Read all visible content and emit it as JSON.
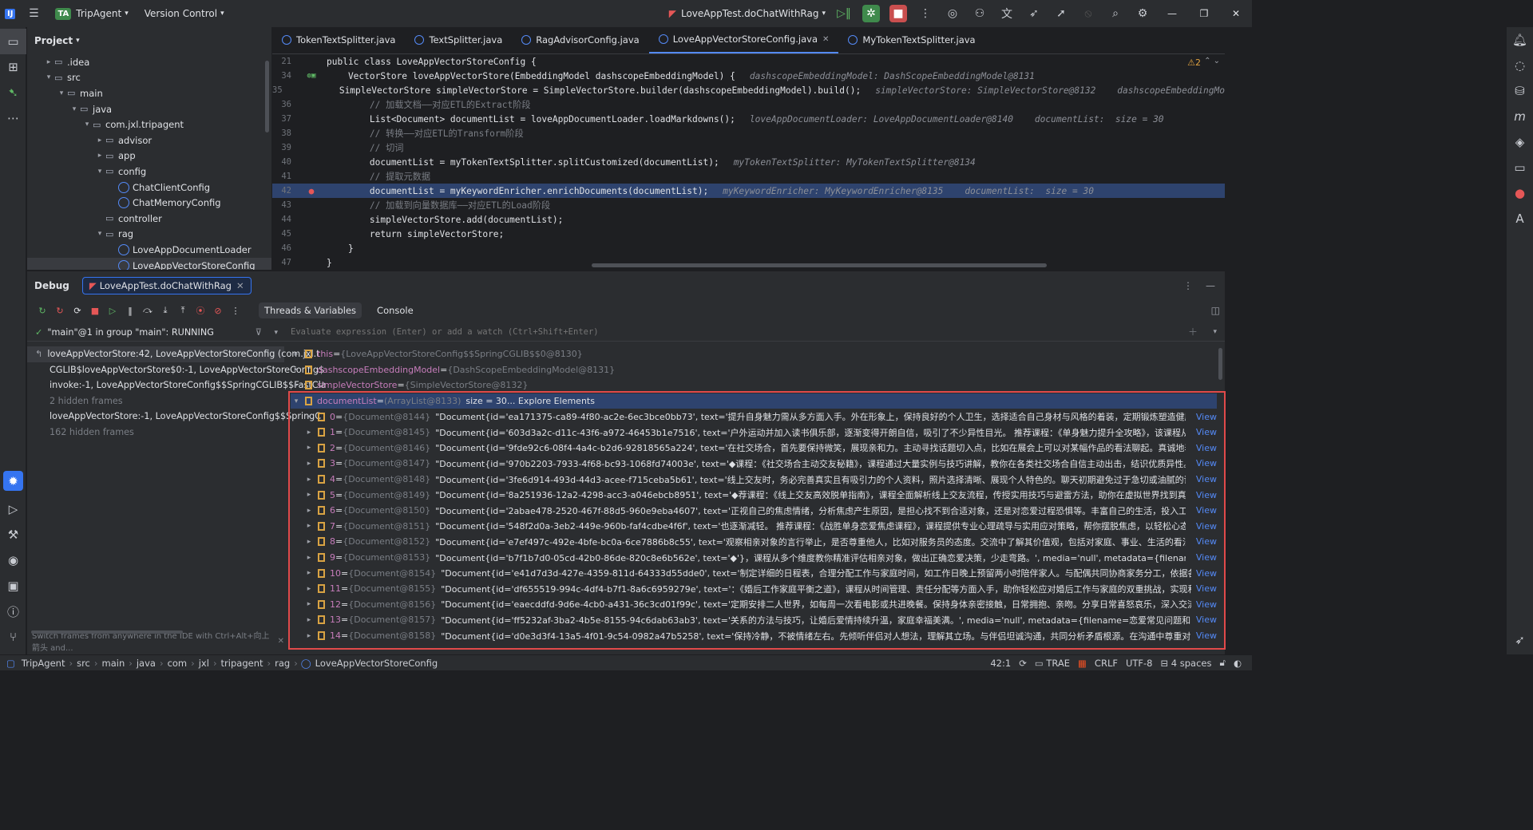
{
  "titlebar": {
    "app_icon": "IJ",
    "project_badge": "TA",
    "project": "TripAgent",
    "vcs": "Version Control",
    "run_config": "LoveAppTest.doChatWithRag"
  },
  "project_panel": {
    "title": "Project",
    "tree": [
      {
        "label": ".idea",
        "depth": 1,
        "arrow": "▸",
        "icon": "folder"
      },
      {
        "label": "src",
        "depth": 1,
        "arrow": "▾",
        "icon": "folder"
      },
      {
        "label": "main",
        "depth": 2,
        "arrow": "▾",
        "icon": "folder"
      },
      {
        "label": "java",
        "depth": 3,
        "arrow": "▾",
        "icon": "folder"
      },
      {
        "label": "com.jxl.tripagent",
        "depth": 4,
        "arrow": "▾",
        "icon": "folder"
      },
      {
        "label": "advisor",
        "depth": 5,
        "arrow": "▸",
        "icon": "folder"
      },
      {
        "label": "app",
        "depth": 5,
        "arrow": "▸",
        "icon": "folder"
      },
      {
        "label": "config",
        "depth": 5,
        "arrow": "▾",
        "icon": "folder"
      },
      {
        "label": "ChatClientConfig",
        "depth": 6,
        "arrow": "",
        "icon": "class"
      },
      {
        "label": "ChatMemoryConfig",
        "depth": 6,
        "arrow": "",
        "icon": "class"
      },
      {
        "label": "controller",
        "depth": 5,
        "arrow": "",
        "icon": "folder"
      },
      {
        "label": "rag",
        "depth": 5,
        "arrow": "▾",
        "icon": "folder"
      },
      {
        "label": "LoveAppDocumentLoader",
        "depth": 6,
        "arrow": "",
        "icon": "class"
      },
      {
        "label": "LoveAppVectorStoreConfig",
        "depth": 6,
        "arrow": "",
        "icon": "class",
        "selected": true
      }
    ]
  },
  "editor": {
    "tabs": [
      "TokenTextSplitter.java",
      "TextSplitter.java",
      "RagAdvisorConfig.java",
      "LoveAppVectorStoreConfig.java",
      "MyTokenTextSplitter.java"
    ],
    "active_tab": 3,
    "warning_count": "⚠2",
    "lines": [
      {
        "n": "21",
        "code": "public class LoveAppVectorStoreConfig {",
        "hint": ""
      },
      {
        "n": "34",
        "code": "    VectorStore loveAppVectorStore(EmbeddingModel dashscopeEmbeddingModel) {",
        "hint": "dashscopeEmbeddingModel: DashScopeEmbeddingModel@8131"
      },
      {
        "n": "35",
        "code": "        SimpleVectorStore simpleVectorStore = SimpleVectorStore.builder(dashscopeEmbeddingModel).build();",
        "hint": "simpleVectorStore: SimpleVectorStore@8132    dashscopeEmbeddingMo"
      },
      {
        "n": "36",
        "code": "        // 加载文档——对应ETL的Extract阶段",
        "hint": ""
      },
      {
        "n": "37",
        "code": "        List<Document> documentList = loveAppDocumentLoader.loadMarkdowns();",
        "hint": "loveAppDocumentLoader: LoveAppDocumentLoader@8140    documentList:  size = 30"
      },
      {
        "n": "38",
        "code": "        // 转换——对应ETL的Transform阶段",
        "hint": ""
      },
      {
        "n": "39",
        "code": "        // 切词",
        "hint": ""
      },
      {
        "n": "40",
        "code": "        documentList = myTokenTextSplitter.splitCustomized(documentList);",
        "hint": "myTokenTextSplitter: MyTokenTextSplitter@8134"
      },
      {
        "n": "41",
        "code": "        // 提取元数据",
        "hint": ""
      },
      {
        "n": "42",
        "code": "        documentList = myKeywordEnricher.enrichDocuments(documentList);",
        "hint": "myKeywordEnricher: MyKeywordEnricher@8135    documentList:  size = 30"
      },
      {
        "n": "43",
        "code": "        // 加载到向量数据库——对应ETL的Load阶段",
        "hint": ""
      },
      {
        "n": "44",
        "code": "        simpleVectorStore.add(documentList);",
        "hint": ""
      },
      {
        "n": "45",
        "code": "        return simpleVectorStore;",
        "hint": ""
      },
      {
        "n": "46",
        "code": "    }",
        "hint": ""
      },
      {
        "n": "47",
        "code": "}",
        "hint": ""
      }
    ]
  },
  "debug": {
    "title": "Debug",
    "session": "LoveAppTest.doChatWithRag",
    "tabs": [
      "Threads & Variables",
      "Console"
    ],
    "thread": "\"main\"@1 in group \"main\": RUNNING",
    "eval_placeholder": "Evaluate expression (Enter) or add a watch (Ctrl+Shift+Enter)",
    "frames": [
      "loveAppVectorStore:42, LoveAppVectorStoreConfig (com.jxl.t",
      "CGLIB$loveAppVectorStore$0:-1, LoveAppVectorStoreConfig$",
      "invoke:-1, LoveAppVectorStoreConfig$$SpringCGLIB$$FastCla",
      "2 hidden frames",
      "loveAppVectorStore:-1, LoveAppVectorStoreConfig$$SpringC",
      "162 hidden frames"
    ],
    "frames_hint": "Switch frames from anywhere in the IDE with Ctrl+Alt+向上箭头 and...",
    "vars": [
      {
        "name": "this",
        "ref": "{LoveAppVectorStoreConfig$$SpringCGLIB$$0@8130}",
        "val": ""
      },
      {
        "name": "dashscopeEmbeddingModel",
        "ref": "{DashScopeEmbeddingModel@8131}",
        "val": ""
      },
      {
        "name": "simpleVectorStore",
        "ref": "{SimpleVectorStore@8132}",
        "val": ""
      },
      {
        "name": "documentList",
        "ref": "(ArrayList@8133)",
        "val": "size = 30... Explore Elements"
      }
    ],
    "docs": [
      {
        "i": "0",
        "ref": "{Document@8144}",
        "val": "\"Document{id='ea171375-ca89-4f80-ac2e-6ec3bce0bb73', text='提升自身魅力需从多方面入手。外在形象上，保持良好的个人卫生，选择适合自己身材与风格的着装，定期锻炼塑造健康体魄。内在修养方面，培养广泛兴"
      },
      {
        "i": "1",
        "ref": "{Document@8145}",
        "val": "\"Document{id='603d3a2c-d11c-43f6-a972-46453b1e7516', text='户外运动并加入读书俱乐部，逐渐变得开朗自信，吸引了不少异性目光。 推荐课程：《单身魅力提升全攻略》，该课程从形象打造、气质培养到社交技巧"
      },
      {
        "i": "2",
        "ref": "{Document@8146}",
        "val": "\"Document{id='9fde92c6-08f4-4a4c-b2d6-92818565a224', text='在社交场合，首先要保持微笑，展现亲和力。主动寻找话题切入点，比如在展会上可以对某幅作品的看法聊起。真诚地表达自己对对方的兴趣，例如\"我看你"
      },
      {
        "i": "3",
        "ref": "{Document@8147}",
        "val": "\"Document{id='970b2203-7933-4f68-bc93-1068fd74003e', text='◆课程：《社交场合主动交友秘籍》，课程通过大量实例与技巧讲解，教你在各类社交场合自信主动出击，结识优质异性。', media='null', metadata={file"
      },
      {
        "i": "4",
        "ref": "{Document@8148}",
        "val": "\"Document{id='3fe6d914-493d-44d3-acee-f715ceba5b61', text='线上交友时，务必完善真实且有吸引力的个人资料，照片选择清晰、展现个人特色的。聊天初期避免过于急切或油腻的话术，从兴趣爱好、日常趣事等轻松"
      },
      {
        "i": "5",
        "ref": "{Document@8149}",
        "val": "\"Document{id='8a251936-12a2-4298-acc3-a046ebcb8951', text='◆荐课程：《线上交友高效脱单指南》，课程全面解析线上交友流程，传授实用技巧与避雷方法，助你在虚拟世界找到真爱。', media='null', metadata={"
      },
      {
        "i": "6",
        "ref": "{Document@8150}",
        "val": "\"Document{id='2abae478-2520-467f-88d5-960e9eba4607', text='正视自己的焦虑情绪，分析焦虑产生原因，是担心找不到合适对象，还是对恋爱过程恐惧等。丰富自己的生活，投入工作、发展兴趣爱好，让生活充实起来"
      },
      {
        "i": "7",
        "ref": "{Document@8151}",
        "val": "\"Document{id='548f2d0a-3eb2-449e-960b-faf4cdbe4f6f', text='也逐渐减轻。 推荐课程：《战胜单身恋爱焦虑课程》，课程提供专业心理疏导与实用应对策略，帮你摆脱焦虑，以轻松心态迎接爱情。', media='null', meta"
      },
      {
        "i": "8",
        "ref": "{Document@8152}",
        "val": "\"Document{id='e7ef497c-492e-4bfe-bc0a-6ce7886b8c55', text='观察相亲对象的言行举止，是否尊重他人，比如对服务员的态度。交流中了解其价值观，包括对家庭、事业、生活的看法是否与你契合。关注对方的情绪稳"
      },
      {
        "i": "9",
        "ref": "{Document@8153}",
        "val": "\"Document{id='b7f1b7d0-05cd-42b0-86de-820c8e6b562e', text='◆'}，课程从多个维度教你精准评估相亲对象，做出正确恋爱决策，少走弯路。', media='null', metadata={filename=恋爱常见问题和回答 - 单身篇.md"
      },
      {
        "i": "10",
        "ref": "{Document@8154}",
        "val": "\"Document{id='e41d7d3d-427e-4359-811d-64333d55dde0', text='制定详细的日程表，合理分配工作与家庭时间，如工作日晚上预留两小时陪伴家人。与配偶共同协商家务分工，依据各自擅长领域安排，如一方擅长烹饪"
      },
      {
        "i": "11",
        "ref": "{Document@8155}",
        "val": "\"Document{id='df655519-994c-4df4-b7f1-8a6c6959279e', text='：《婚后工作家庭平衡之道》，课程从时间管理、责任分配等方面入手，助你轻松应对婚后工作与家庭的双重挑战，实现和谐生活。', media='null', metac"
      },
      {
        "i": "12",
        "ref": "{Document@8156}",
        "val": "\"Document{id='eaecddfd-9d6e-4cb0-a431-36c3cd01f99c', text='定期安排二人世界，如每周一次看电影或共进晚餐。保持身体亲密接触，日常拥抱、亲吻。分享日常喜怒哀乐，深入交流内心想法。一起回忆美好过往，"
      },
      {
        "i": "13",
        "ref": "{Document@8157}",
        "val": "\"Document{id='ff5232af-3ba2-4b5e-8155-94c6dab63ab3', text='关系的方法与技巧，让婚后爱情持续升温，家庭幸福美满。', media='null', metadata={filename=恋爱常见问题和回答 - 已婚篇.md, category=header"
      },
      {
        "i": "14",
        "ref": "{Document@8158}",
        "val": "\"Document{id='d0e3d3f4-13a5-4f01-9c54-0982a47b5258', text='保持冷静，不被情绪左右。先倾听伴侣对人想法，理解其立场。与伴侣坦诚沟通，共同分析矛盾根源。在沟通中尊重对方家人，用温和语气表达自己观点"
      }
    ],
    "view_label": "View"
  },
  "statusbar": {
    "path": [
      "TripAgent",
      "src",
      "main",
      "java",
      "com",
      "jxl",
      "tripagent",
      "rag",
      "LoveAppVectorStoreConfig"
    ],
    "position": "42:1",
    "plugin": "TRAE",
    "line_sep": "CRLF",
    "encoding": "UTF-8",
    "indent": "4 spaces"
  },
  "colors": {
    "accent": "#548af7",
    "highlight_border": "#e04a4a",
    "breakpoint": "#e55757"
  }
}
